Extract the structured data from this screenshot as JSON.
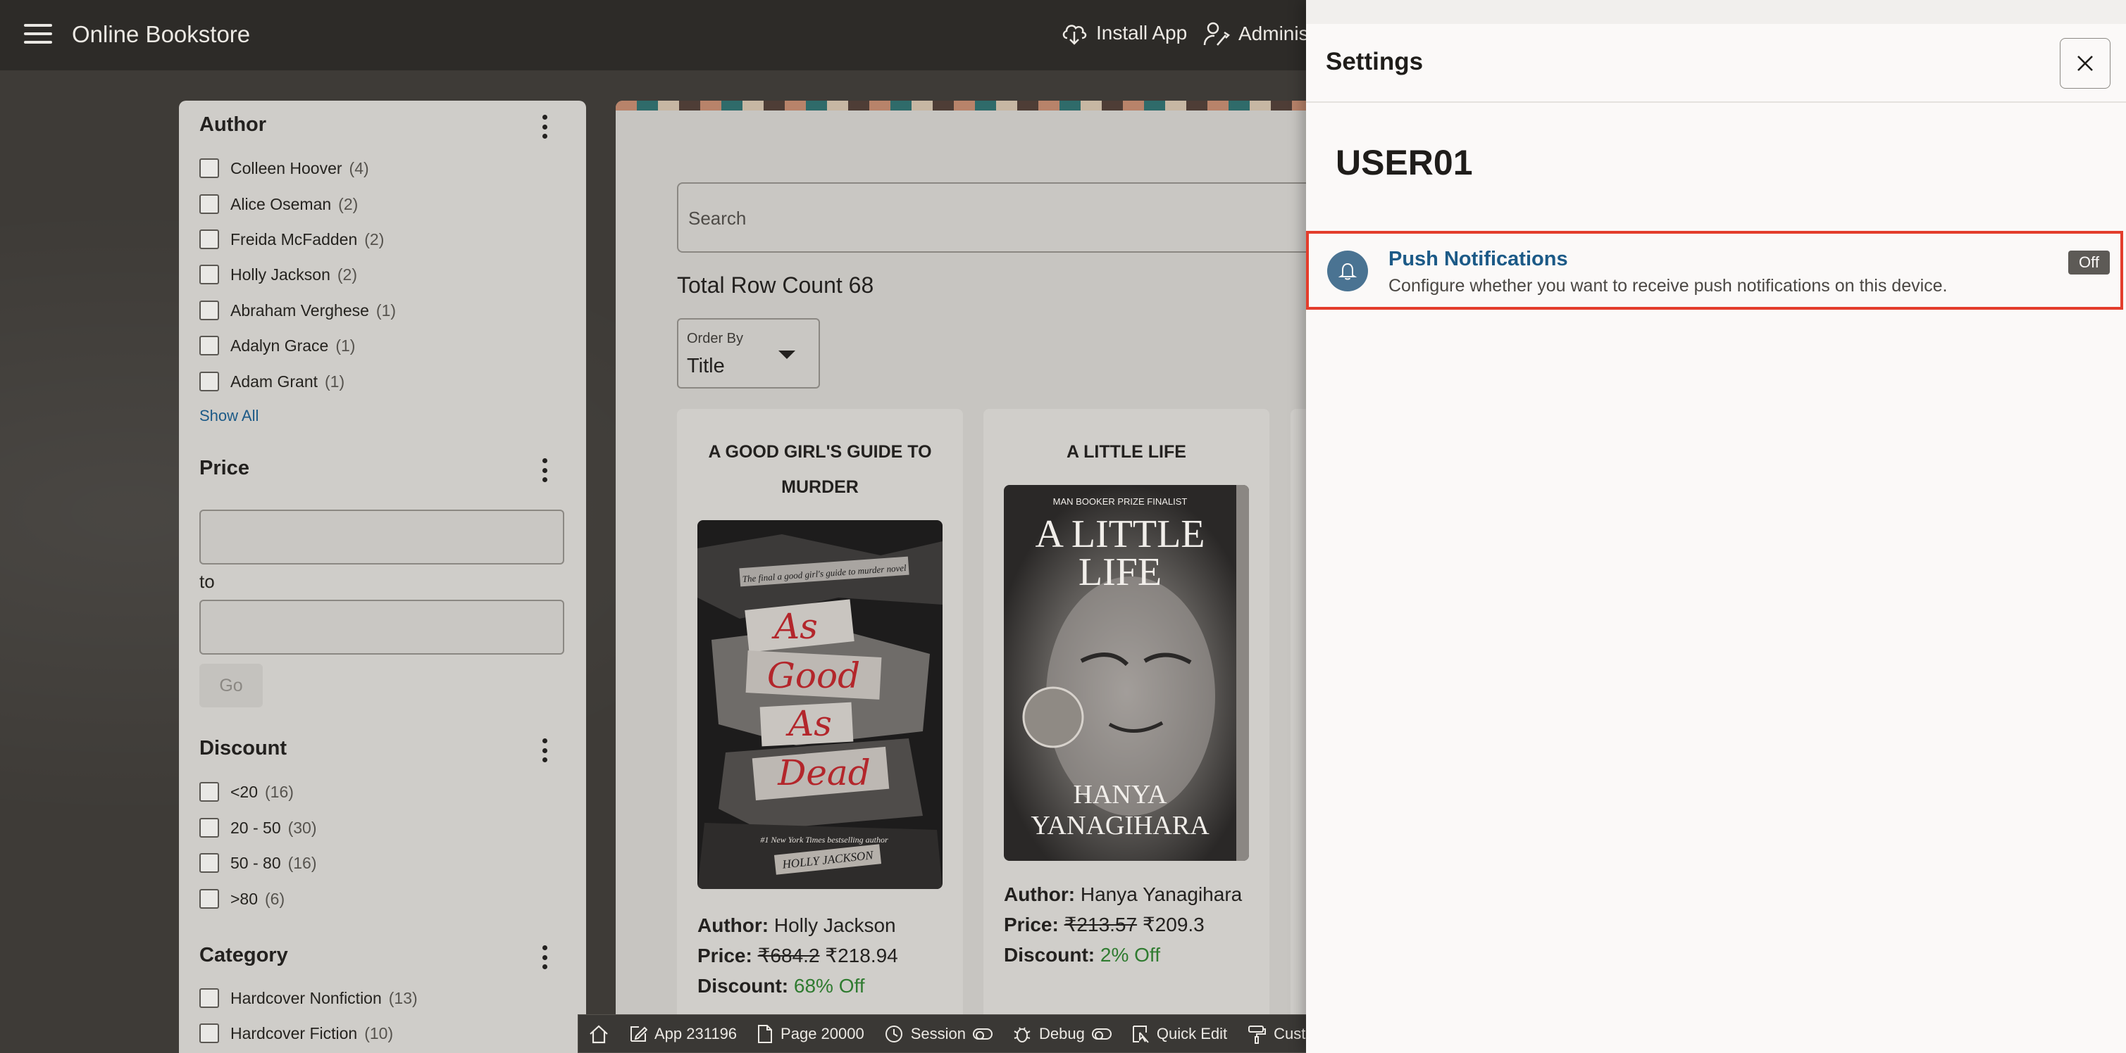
{
  "header": {
    "app_title": "Online Bookstore",
    "install_app": "Install App",
    "admin": "Adminis"
  },
  "facets": {
    "author": {
      "title": "Author",
      "items": [
        {
          "label": "Colleen Hoover",
          "count": "(4)"
        },
        {
          "label": "Alice Oseman",
          "count": "(2)"
        },
        {
          "label": "Freida McFadden",
          "count": "(2)"
        },
        {
          "label": "Holly Jackson",
          "count": "(2)"
        },
        {
          "label": "Abraham Verghese",
          "count": "(1)"
        },
        {
          "label": "Adalyn Grace",
          "count": "(1)"
        },
        {
          "label": "Adam Grant",
          "count": "(1)"
        }
      ],
      "show_all": "Show All"
    },
    "price": {
      "title": "Price",
      "to_label": "to",
      "go_label": "Go"
    },
    "discount": {
      "title": "Discount",
      "items": [
        {
          "label": "<20",
          "count": "(16)"
        },
        {
          "label": "20 - 50",
          "count": "(30)"
        },
        {
          "label": "50 - 80",
          "count": "(16)"
        },
        {
          "label": ">80",
          "count": "(6)"
        }
      ]
    },
    "category": {
      "title": "Category",
      "items": [
        {
          "label": "Hardcover Nonfiction",
          "count": "(13)"
        },
        {
          "label": "Hardcover Fiction",
          "count": "(10)"
        }
      ]
    }
  },
  "main": {
    "search_placeholder": "Search",
    "row_count": "Total Row Count 68",
    "order_by_label": "Order By",
    "order_by_value": "Title",
    "cards": [
      {
        "title": "A GOOD GIRL'S GUIDE TO MURDER",
        "author_label": "Author:",
        "author": "Holly Jackson",
        "price_label": "Price:",
        "old_price": "₹684.2",
        "new_price": "₹218.94",
        "discount_label": "Discount:",
        "discount": "68% Off",
        "cover": {
          "tagline": "The final a good girl's guide to murder novel",
          "title_lines": [
            "As",
            "Good",
            "As",
            "Dead"
          ],
          "blurb": "#1 New York Times bestselling author",
          "author": "HOLLY JACKSON"
        }
      },
      {
        "title": "A LITTLE LIFE",
        "author_label": "Author:",
        "author": "Hanya Yanagihara",
        "price_label": "Price:",
        "old_price": "₹213.57",
        "new_price": "₹209.3",
        "discount_label": "Discount:",
        "discount": "2% Off",
        "cover": {
          "tagline": "MAN BOOKER PRIZE FINALIST",
          "title_lines": [
            "A LITTLE",
            "LIFE"
          ],
          "author_lines": [
            "HANYA",
            "YANAGIHARA"
          ]
        }
      }
    ]
  },
  "devbar": {
    "app": "App 231196",
    "page": "Page 20000",
    "session": "Session",
    "debug": "Debug",
    "quick_edit": "Quick Edit",
    "customize": "Customize"
  },
  "settings": {
    "title": "Settings",
    "user": "USER01",
    "push_title": "Push Notifications",
    "push_desc": "Configure whether you want to receive push notifications on this device.",
    "push_state": "Off"
  },
  "colors": {
    "accent_link": "#1c5a87",
    "highlight_border": "#e33d2c",
    "discount_green": "#2f7b30",
    "header_bg": "#2d2b28"
  }
}
